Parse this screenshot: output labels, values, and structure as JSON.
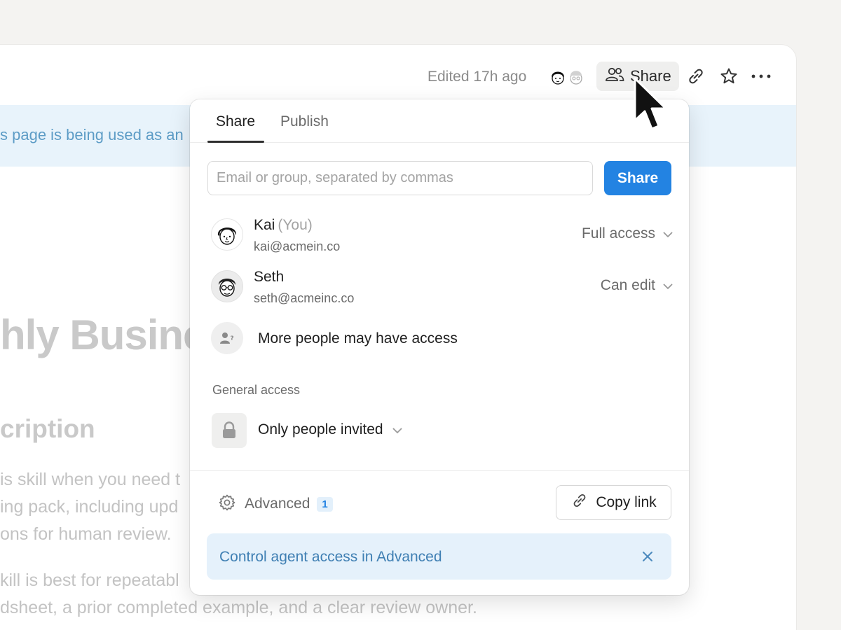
{
  "topbar": {
    "edited_text": "Edited 17h ago",
    "share_label": "Share"
  },
  "background_page": {
    "banner_text": "s page is being used as an",
    "title_fragment": "hly Busine",
    "heading_fragment": "cription",
    "paragraph1": [
      "is skill when you need t",
      "ing pack, including upd",
      "ons for human review."
    ],
    "paragraph2": [
      "kill is best for repeatabl",
      "dsheet, a prior completed example, and a clear review owner."
    ]
  },
  "share_popover": {
    "tabs": [
      {
        "label": "Share",
        "active": true
      },
      {
        "label": "Publish",
        "active": false
      }
    ],
    "email_input": {
      "value": "",
      "placeholder": "Email or group, separated by commas"
    },
    "share_button_label": "Share",
    "people": [
      {
        "name": "Kai",
        "suffix": "(You)",
        "email": "kai@acmein.co",
        "permission": "Full access"
      },
      {
        "name": "Seth",
        "suffix": "",
        "email": "seth@acmeinc.co",
        "permission": "Can edit"
      }
    ],
    "more_people_text": "More people may have access",
    "general_access": {
      "label": "General access",
      "value": "Only people invited"
    },
    "advanced": {
      "label": "Advanced",
      "badge": "1"
    },
    "copy_link_label": "Copy link",
    "notice_text": "Control agent access in Advanced"
  },
  "colors": {
    "accent": "#2383e2",
    "banner_bg": "#e8f3fb",
    "notice_text": "#3f7fb3"
  },
  "icons": {
    "share_top": "people-icon",
    "link": "link-icon",
    "favorite": "star-icon",
    "more": "more-horizontal-icon",
    "permission_dropdown": "chevron-down-icon",
    "more_people": "person-question-icon",
    "general_access": "lock-icon",
    "advanced": "gear-icon",
    "copy_link": "link-icon",
    "notice_close": "close-icon"
  }
}
